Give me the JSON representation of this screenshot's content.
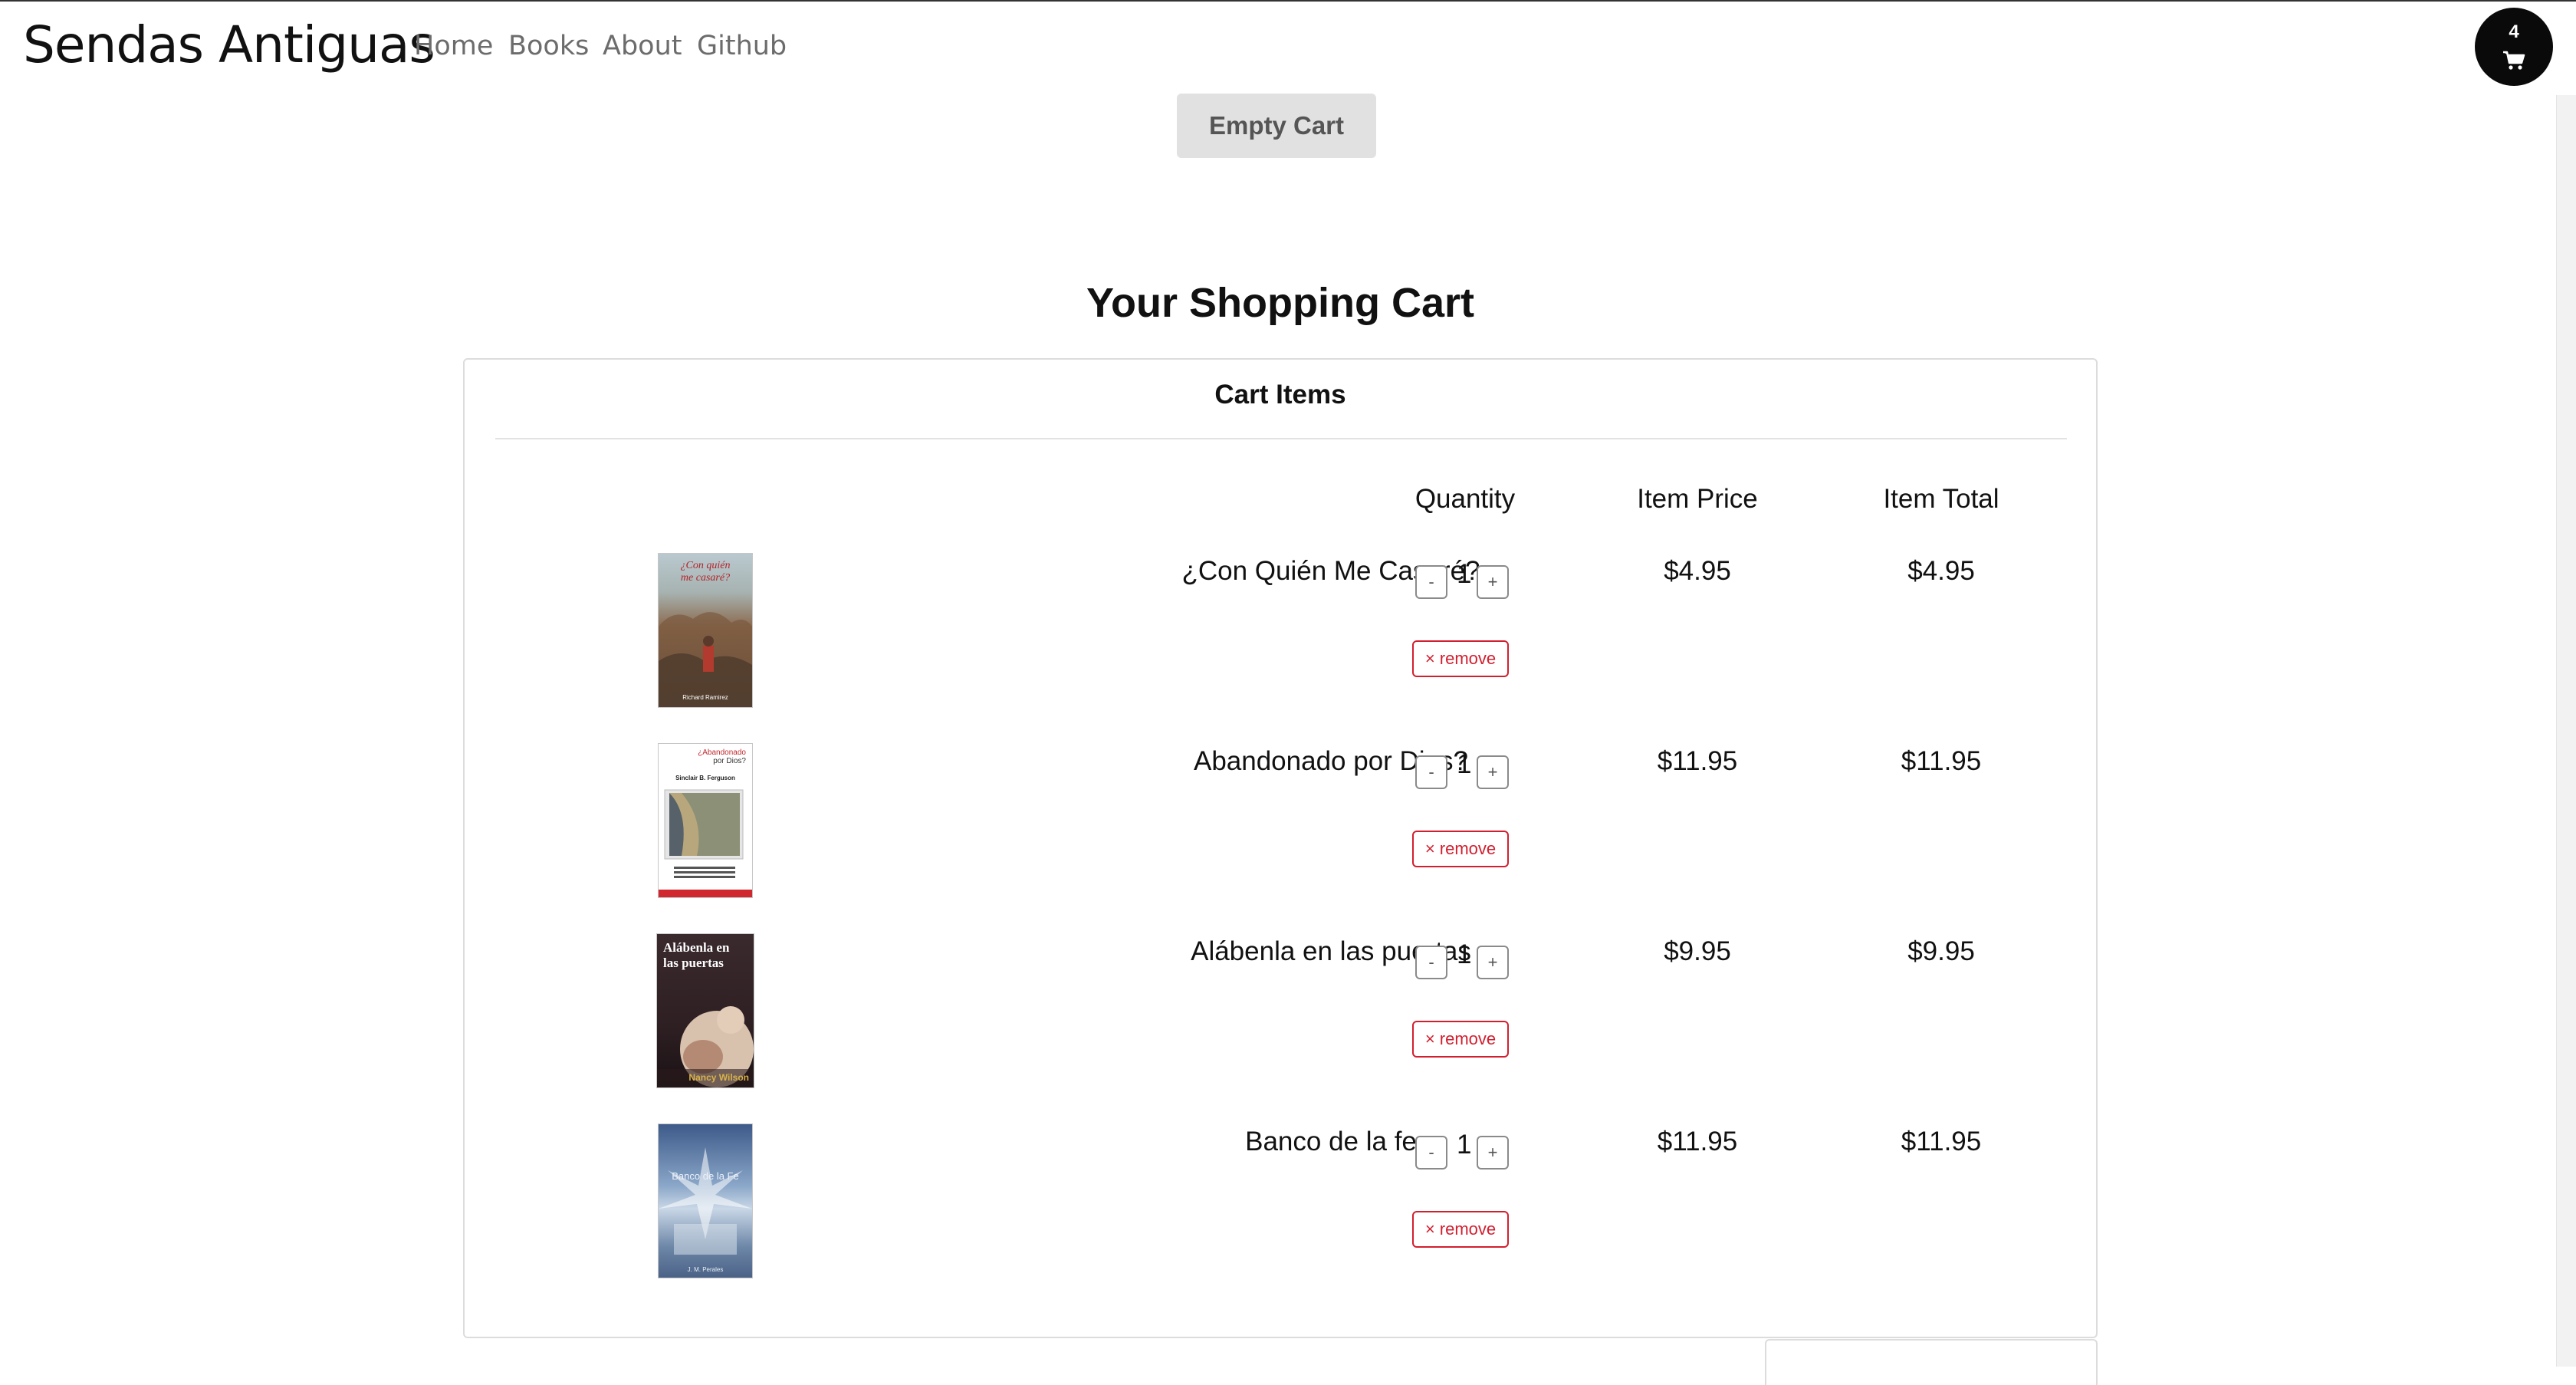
{
  "brand": "Sendas Antiguas",
  "nav": {
    "home": "Home",
    "books": "Books",
    "about": "About",
    "github": "Github"
  },
  "cart_badge": {
    "count": "4",
    "icon": "shopping-cart-icon"
  },
  "empty_cart_label": "Empty Cart",
  "page_title": "Your Shopping Cart",
  "cart": {
    "header": "Cart Items",
    "columns": {
      "quantity": "Quantity",
      "item_price": "Item Price",
      "item_total": "Item Total"
    },
    "items": [
      {
        "title": "¿Con Quién Me Casaré?",
        "qty": "1",
        "price": "$4.95",
        "total": "$4.95",
        "minus": "-",
        "plus": "+",
        "remove": "× remove",
        "cover": {
          "line1": "¿Con quién",
          "line2": "me casaré?",
          "author": "Richard Ramirez"
        }
      },
      {
        "title": "Abandonado por Dios?",
        "qty": "1",
        "price": "$11.95",
        "total": "$11.95",
        "minus": "-",
        "plus": "+",
        "remove": "× remove",
        "cover": {
          "line1": "¿Abandonado",
          "line2": "por Dios?",
          "author": "Sinclair B. Ferguson"
        }
      },
      {
        "title": "Alábenla en las puertas",
        "qty": "1",
        "price": "$9.95",
        "total": "$9.95",
        "minus": "-",
        "plus": "+",
        "remove": "× remove",
        "cover": {
          "line1": "Alábenla en",
          "line2": "las puertas",
          "author": "Nancy Wilson"
        }
      },
      {
        "title": "Banco de la fe",
        "qty": "1",
        "price": "$11.95",
        "total": "$11.95",
        "minus": "-",
        "plus": "+",
        "remove": "× remove",
        "cover": {
          "line1": "Banco de la Fe",
          "line2": "",
          "author": "J. M. Perales"
        }
      }
    ]
  },
  "colors": {
    "brand_dark": "#0a0a0a",
    "remove_red": "#d21f2f",
    "nav_gray": "#6c6c6c"
  }
}
